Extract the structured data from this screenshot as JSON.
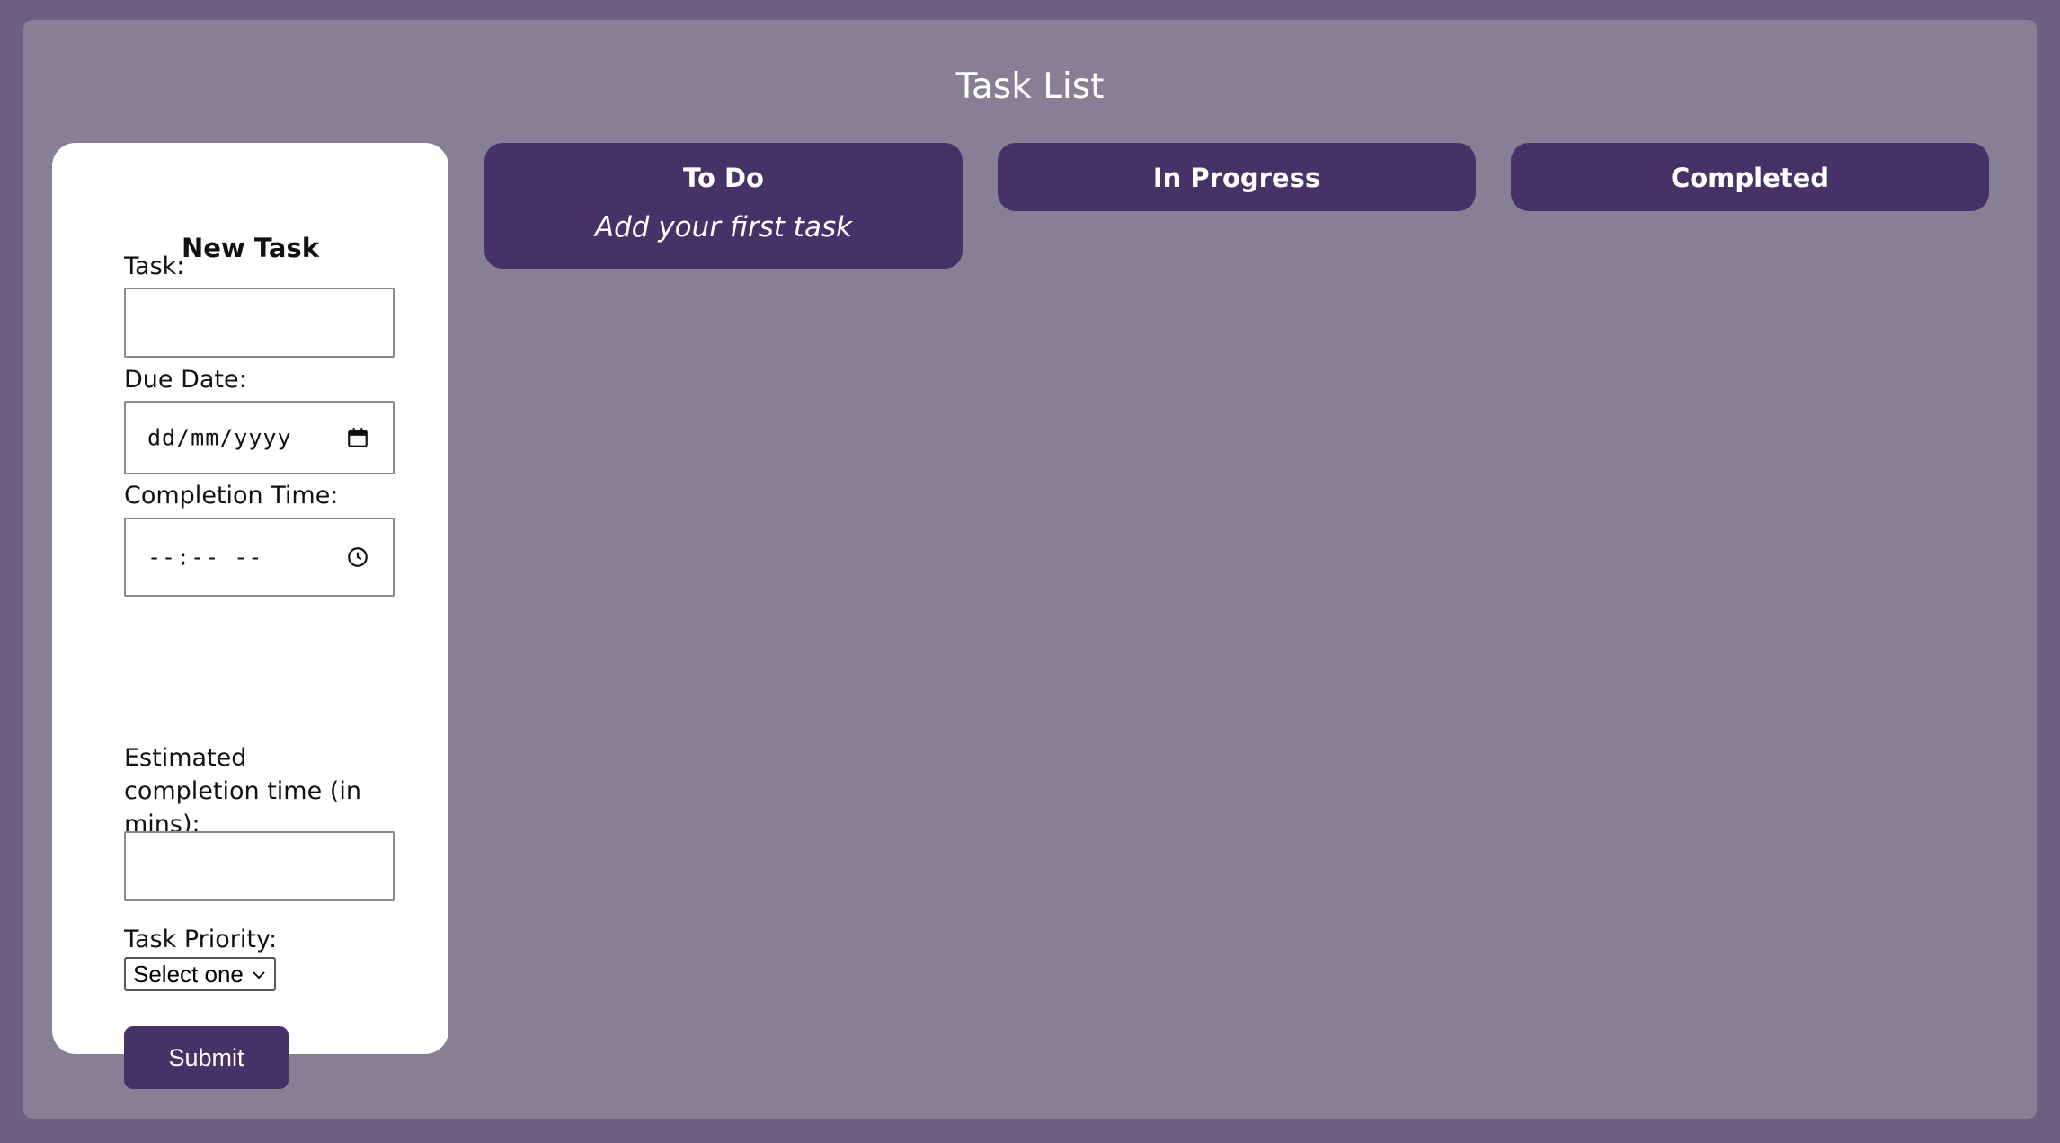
{
  "page": {
    "title": "Task List"
  },
  "form": {
    "heading": "New Task",
    "task_label": "Task:",
    "task_value": "",
    "due_date_label": "Due Date:",
    "due_date_placeholder": "dd/mm/yyyy",
    "completion_time_label": "Completion Time:",
    "completion_time_placeholder": "--:-- --",
    "estimate_label": "Estimated completion time (in mins):",
    "estimate_value": "",
    "priority_label": "Task Priority:",
    "priority_selected": "Select one",
    "submit_label": "Submit"
  },
  "columns": [
    {
      "title": "To Do",
      "empty_text": "Add your first task"
    },
    {
      "title": "In Progress"
    },
    {
      "title": "Completed"
    }
  ],
  "colors": {
    "background": "#6c5f82",
    "board": "#877f95",
    "accent": "#473268",
    "panel": "#ffffff"
  },
  "icons": {
    "date_picker": "calendar-icon",
    "time_picker": "clock-icon",
    "select": "chevron-down-icon"
  }
}
